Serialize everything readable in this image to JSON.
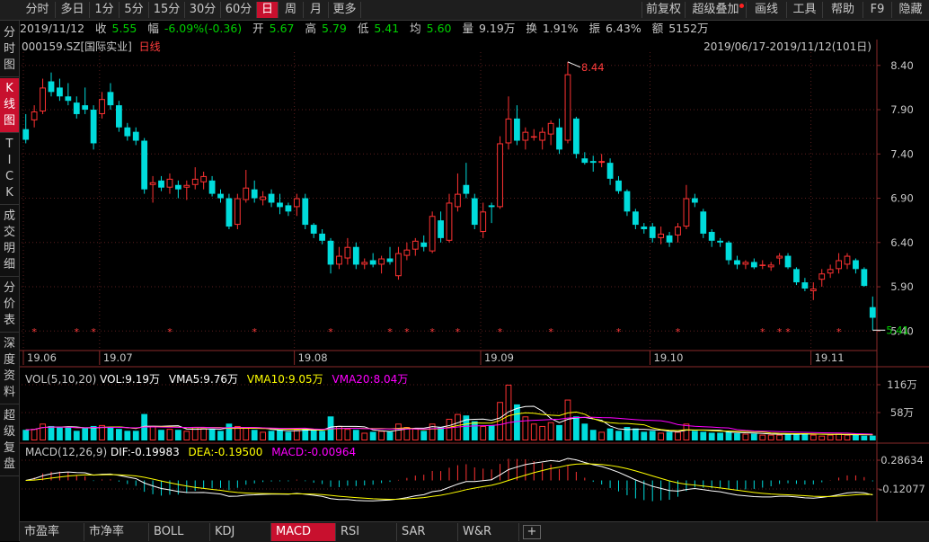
{
  "colors": {
    "up": "#ff3232",
    "down": "#00dcdc",
    "grid": "#5a1e1e",
    "axis": "#8a2a2a",
    "white": "#ffffff",
    "yellow": "#ffff00",
    "magenta": "#ff00ff",
    "green": "#00d000",
    "red": "#ff3c3c"
  },
  "toolbar": {
    "periods": [
      "分时",
      "多日",
      "1分",
      "5分",
      "15分",
      "30分",
      "60分",
      "日",
      "周",
      "月",
      "更多"
    ],
    "active_period": "日",
    "right_items": [
      "前复权",
      "超级叠加",
      "画线",
      "工具",
      "帮助",
      "F9",
      "隐藏"
    ]
  },
  "info": {
    "date": "2019/11/12",
    "close_label": "收",
    "close": "5.55",
    "amp_label": "幅",
    "change": "-6.09%(-0.36)",
    "open_label": "开",
    "open": "5.67",
    "high_label": "高",
    "high": "5.79",
    "low_label": "低",
    "low": "5.41",
    "avg_label": "均",
    "avg": "5.60",
    "vol_label": "量",
    "vol": "9.19万",
    "turn_label": "换",
    "turn": "1.91%",
    "swing_label": "振",
    "swing": "6.43%",
    "amount_label": "额",
    "amount": "5152万"
  },
  "sidebar": [
    "分时图",
    "K线图",
    "TICK",
    "成交明细",
    "分价表",
    "深度资料",
    "超级复盘"
  ],
  "sidebar_active": "K线图",
  "stock": {
    "code": "000159.SZ",
    "name": "[国际实业]",
    "kline_type": "日线"
  },
  "date_range": "2019/06/17-2019/11/12(101日)",
  "price_axis": {
    "ticks": [
      "8.40",
      "7.90",
      "7.40",
      "6.90",
      "6.40",
      "5.90",
      "5.40"
    ],
    "min": 5.2,
    "max": 8.55
  },
  "annotations": {
    "max": "8.44",
    "min": "5.41"
  },
  "month_labels": [
    "19.06",
    "19.07",
    "19.08",
    "19.09",
    "19.10",
    "19.11"
  ],
  "vol": {
    "title": "VOL(5,10,20)",
    "vol": "VOL:9.19万",
    "vma5": "VMA5:9.76万",
    "vma10": "VMA10:9.05万",
    "vma20": "VMA20:8.04万",
    "ticks": [
      "116万",
      "58万"
    ],
    "max": 116
  },
  "macd": {
    "title": "MACD(12,26,9)",
    "dif": "DIF:-0.19983",
    "dea": "DEA:-0.19500",
    "macd": "MACD:-0.00964",
    "ticks": [
      "0.28634",
      "-0.12077"
    ]
  },
  "bottom_tabs": [
    "市盈率",
    "市净率",
    "BOLL",
    "KDJ",
    "MACD",
    "RSI",
    "SAR",
    "W&R"
  ],
  "bottom_active": "MACD",
  "plus": "+",
  "chart_data": {
    "type": "candlestick",
    "series": [
      {
        "o": 7.68,
        "h": 7.85,
        "l": 7.52,
        "c": 7.56
      },
      {
        "o": 7.78,
        "h": 7.95,
        "l": 7.7,
        "c": 7.88
      },
      {
        "o": 7.88,
        "h": 8.25,
        "l": 7.85,
        "c": 8.15
      },
      {
        "o": 8.22,
        "h": 8.32,
        "l": 8.05,
        "c": 8.1
      },
      {
        "o": 8.15,
        "h": 8.25,
        "l": 8.0,
        "c": 8.05
      },
      {
        "o": 8.05,
        "h": 8.2,
        "l": 7.95,
        "c": 8.0
      },
      {
        "o": 7.98,
        "h": 8.05,
        "l": 7.8,
        "c": 7.85
      },
      {
        "o": 7.95,
        "h": 8.15,
        "l": 7.85,
        "c": 7.9
      },
      {
        "o": 7.9,
        "h": 7.95,
        "l": 7.45,
        "c": 7.52
      },
      {
        "o": 7.85,
        "h": 8.1,
        "l": 7.8,
        "c": 8.02
      },
      {
        "o": 8.1,
        "h": 8.2,
        "l": 7.9,
        "c": 7.95
      },
      {
        "o": 7.95,
        "h": 8.0,
        "l": 7.65,
        "c": 7.7
      },
      {
        "o": 7.7,
        "h": 7.75,
        "l": 7.55,
        "c": 7.6
      },
      {
        "o": 7.65,
        "h": 7.7,
        "l": 7.5,
        "c": 7.55
      },
      {
        "o": 7.55,
        "h": 7.58,
        "l": 6.95,
        "c": 7.0
      },
      {
        "o": 7.05,
        "h": 7.15,
        "l": 6.85,
        "c": 7.08
      },
      {
        "o": 7.1,
        "h": 7.15,
        "l": 6.98,
        "c": 7.02
      },
      {
        "o": 7.02,
        "h": 7.18,
        "l": 6.95,
        "c": 7.12
      },
      {
        "o": 7.05,
        "h": 7.1,
        "l": 6.9,
        "c": 7.0
      },
      {
        "o": 7.02,
        "h": 7.1,
        "l": 6.88,
        "c": 7.05
      },
      {
        "o": 7.05,
        "h": 7.25,
        "l": 7.0,
        "c": 7.12
      },
      {
        "o": 7.08,
        "h": 7.2,
        "l": 7.0,
        "c": 7.15
      },
      {
        "o": 7.1,
        "h": 7.15,
        "l": 6.92,
        "c": 6.95
      },
      {
        "o": 6.95,
        "h": 7.0,
        "l": 6.85,
        "c": 6.9
      },
      {
        "o": 6.9,
        "h": 6.95,
        "l": 6.55,
        "c": 6.58
      },
      {
        "o": 6.6,
        "h": 6.95,
        "l": 6.55,
        "c": 6.9
      },
      {
        "o": 6.88,
        "h": 7.22,
        "l": 6.85,
        "c": 7.02
      },
      {
        "o": 7.0,
        "h": 7.1,
        "l": 6.85,
        "c": 6.9
      },
      {
        "o": 6.88,
        "h": 6.98,
        "l": 6.82,
        "c": 6.92
      },
      {
        "o": 6.95,
        "h": 7.0,
        "l": 6.8,
        "c": 6.85
      },
      {
        "o": 6.85,
        "h": 6.95,
        "l": 6.72,
        "c": 6.8
      },
      {
        "o": 6.82,
        "h": 6.85,
        "l": 6.7,
        "c": 6.75
      },
      {
        "o": 6.8,
        "h": 6.95,
        "l": 6.7,
        "c": 6.9
      },
      {
        "o": 6.9,
        "h": 6.95,
        "l": 6.55,
        "c": 6.6
      },
      {
        "o": 6.6,
        "h": 6.62,
        "l": 6.45,
        "c": 6.5
      },
      {
        "o": 6.5,
        "h": 6.55,
        "l": 6.38,
        "c": 6.42
      },
      {
        "o": 6.42,
        "h": 6.45,
        "l": 6.05,
        "c": 6.15
      },
      {
        "o": 6.15,
        "h": 6.35,
        "l": 6.1,
        "c": 6.25
      },
      {
        "o": 6.22,
        "h": 6.45,
        "l": 6.15,
        "c": 6.35
      },
      {
        "o": 6.35,
        "h": 6.4,
        "l": 6.1,
        "c": 6.15
      },
      {
        "o": 6.15,
        "h": 6.22,
        "l": 6.1,
        "c": 6.18
      },
      {
        "o": 6.2,
        "h": 6.28,
        "l": 6.12,
        "c": 6.15
      },
      {
        "o": 6.15,
        "h": 6.25,
        "l": 6.05,
        "c": 6.22
      },
      {
        "o": 6.22,
        "h": 6.35,
        "l": 6.15,
        "c": 6.18
      },
      {
        "o": 6.02,
        "h": 6.35,
        "l": 5.98,
        "c": 6.28
      },
      {
        "o": 6.25,
        "h": 6.4,
        "l": 6.2,
        "c": 6.32
      },
      {
        "o": 6.32,
        "h": 6.45,
        "l": 6.25,
        "c": 6.42
      },
      {
        "o": 6.4,
        "h": 6.48,
        "l": 6.3,
        "c": 6.35
      },
      {
        "o": 6.3,
        "h": 6.75,
        "l": 6.28,
        "c": 6.7
      },
      {
        "o": 6.65,
        "h": 6.75,
        "l": 6.4,
        "c": 6.45
      },
      {
        "o": 6.42,
        "h": 6.95,
        "l": 6.4,
        "c": 6.85
      },
      {
        "o": 6.8,
        "h": 7.18,
        "l": 6.75,
        "c": 6.95
      },
      {
        "o": 7.05,
        "h": 7.3,
        "l": 6.9,
        "c": 6.95
      },
      {
        "o": 6.9,
        "h": 6.95,
        "l": 6.55,
        "c": 6.6
      },
      {
        "o": 6.52,
        "h": 6.85,
        "l": 6.45,
        "c": 6.75
      },
      {
        "o": 6.82,
        "h": 6.85,
        "l": 6.62,
        "c": 6.8
      },
      {
        "o": 6.8,
        "h": 7.6,
        "l": 6.78,
        "c": 7.52
      },
      {
        "o": 7.52,
        "h": 8.05,
        "l": 7.45,
        "c": 7.8
      },
      {
        "o": 7.8,
        "h": 7.95,
        "l": 7.5,
        "c": 7.55
      },
      {
        "o": 7.55,
        "h": 7.7,
        "l": 7.45,
        "c": 7.65
      },
      {
        "o": 7.6,
        "h": 7.68,
        "l": 7.55,
        "c": 7.6
      },
      {
        "o": 7.55,
        "h": 7.7,
        "l": 7.45,
        "c": 7.65
      },
      {
        "o": 7.62,
        "h": 7.78,
        "l": 7.5,
        "c": 7.75
      },
      {
        "o": 7.7,
        "h": 7.8,
        "l": 7.4,
        "c": 7.45
      },
      {
        "o": 7.55,
        "h": 8.44,
        "l": 7.52,
        "c": 8.3
      },
      {
        "o": 7.8,
        "h": 7.82,
        "l": 7.35,
        "c": 7.4
      },
      {
        "o": 7.35,
        "h": 7.42,
        "l": 7.28,
        "c": 7.3
      },
      {
        "o": 7.32,
        "h": 7.38,
        "l": 7.2,
        "c": 7.3
      },
      {
        "o": 7.3,
        "h": 7.4,
        "l": 7.25,
        "c": 7.32
      },
      {
        "o": 7.3,
        "h": 7.35,
        "l": 7.05,
        "c": 7.12
      },
      {
        "o": 7.1,
        "h": 7.15,
        "l": 6.95,
        "c": 6.98
      },
      {
        "o": 6.98,
        "h": 7.0,
        "l": 6.7,
        "c": 6.75
      },
      {
        "o": 6.75,
        "h": 6.78,
        "l": 6.55,
        "c": 6.6
      },
      {
        "o": 6.58,
        "h": 6.62,
        "l": 6.5,
        "c": 6.55
      },
      {
        "o": 6.58,
        "h": 6.62,
        "l": 6.4,
        "c": 6.45
      },
      {
        "o": 6.45,
        "h": 6.58,
        "l": 6.38,
        "c": 6.5
      },
      {
        "o": 6.48,
        "h": 6.52,
        "l": 6.35,
        "c": 6.4
      },
      {
        "o": 6.48,
        "h": 6.62,
        "l": 6.4,
        "c": 6.58
      },
      {
        "o": 6.58,
        "h": 7.05,
        "l": 6.55,
        "c": 6.9
      },
      {
        "o": 6.9,
        "h": 6.95,
        "l": 6.8,
        "c": 6.85
      },
      {
        "o": 6.75,
        "h": 6.78,
        "l": 6.45,
        "c": 6.5
      },
      {
        "o": 6.52,
        "h": 6.55,
        "l": 6.35,
        "c": 6.42
      },
      {
        "o": 6.42,
        "h": 6.45,
        "l": 6.35,
        "c": 6.4
      },
      {
        "o": 6.4,
        "h": 6.42,
        "l": 6.15,
        "c": 6.2
      },
      {
        "o": 6.2,
        "h": 6.25,
        "l": 6.1,
        "c": 6.15
      },
      {
        "o": 6.15,
        "h": 6.2,
        "l": 6.1,
        "c": 6.18
      },
      {
        "o": 6.18,
        "h": 6.22,
        "l": 6.1,
        "c": 6.12
      },
      {
        "o": 6.15,
        "h": 6.2,
        "l": 6.1,
        "c": 6.15
      },
      {
        "o": 6.12,
        "h": 6.18,
        "l": 6.08,
        "c": 6.15
      },
      {
        "o": 6.22,
        "h": 6.28,
        "l": 6.15,
        "c": 6.25
      },
      {
        "o": 6.25,
        "h": 6.28,
        "l": 6.1,
        "c": 6.12
      },
      {
        "o": 6.1,
        "h": 6.12,
        "l": 5.92,
        "c": 5.95
      },
      {
        "o": 5.95,
        "h": 6.0,
        "l": 5.85,
        "c": 5.88
      },
      {
        "o": 5.85,
        "h": 5.95,
        "l": 5.75,
        "c": 5.88
      },
      {
        "o": 5.98,
        "h": 6.1,
        "l": 5.9,
        "c": 6.05
      },
      {
        "o": 6.05,
        "h": 6.15,
        "l": 6.0,
        "c": 6.1
      },
      {
        "o": 6.1,
        "h": 6.28,
        "l": 6.05,
        "c": 6.2
      },
      {
        "o": 6.15,
        "h": 6.28,
        "l": 6.1,
        "c": 6.25
      },
      {
        "o": 6.2,
        "h": 6.22,
        "l": 6.05,
        "c": 6.1
      },
      {
        "o": 6.1,
        "h": 6.12,
        "l": 5.9,
        "c": 5.91
      },
      {
        "o": 5.67,
        "h": 5.79,
        "l": 5.41,
        "c": 5.55
      }
    ],
    "volume": [
      22,
      24,
      35,
      30,
      28,
      27,
      20,
      26,
      30,
      32,
      28,
      24,
      20,
      20,
      55,
      30,
      22,
      24,
      22,
      20,
      28,
      25,
      24,
      20,
      35,
      30,
      26,
      22,
      18,
      20,
      22,
      18,
      22,
      25,
      22,
      20,
      50,
      30,
      24,
      22,
      16,
      18,
      20,
      18,
      35,
      28,
      26,
      20,
      35,
      28,
      45,
      55,
      52,
      40,
      30,
      32,
      80,
      116,
      75,
      50,
      35,
      30,
      38,
      32,
      85,
      50,
      35,
      22,
      18,
      25,
      20,
      28,
      25,
      18,
      20,
      16,
      18,
      18,
      35,
      20,
      18,
      16,
      16,
      18,
      15,
      14,
      14,
      12,
      12,
      12,
      14,
      14,
      15,
      12,
      10,
      12,
      14,
      12,
      12,
      10,
      10
    ],
    "star_indices": [
      1,
      6,
      8,
      17,
      27,
      36,
      43,
      45,
      48,
      51,
      56,
      62,
      70,
      77,
      87,
      89,
      90,
      96
    ],
    "month_indices": [
      0,
      9,
      32,
      54,
      74,
      93
    ],
    "ylim": [
      5.2,
      8.55
    ]
  }
}
